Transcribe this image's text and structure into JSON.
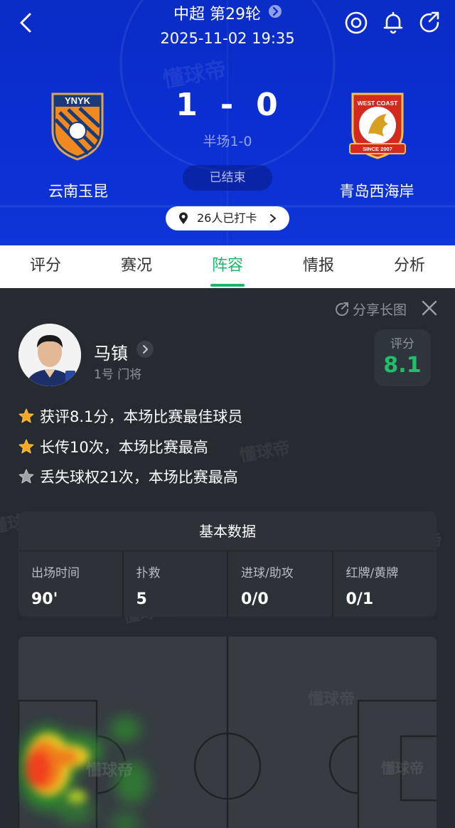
{
  "header": {
    "league_round": "中超 第29轮",
    "datetime": "2025-11-02 19:35",
    "score_home": "1",
    "score_sep": "-",
    "score_away": "0",
    "halftime": "半场1-0",
    "status": "已结束",
    "home_team": "云南玉昆",
    "away_team": "青岛西海岸",
    "checkin": "26人已打卡",
    "home_logo_text": "YNYK",
    "away_logo_text_top": "WEST COAST",
    "away_logo_text_bottom": "SINCE 2007",
    "watermark": "懂球帝",
    "colors": {
      "bg": "#0b2fd2",
      "accent": "#20b46a"
    }
  },
  "tabs": [
    {
      "label": "评分"
    },
    {
      "label": "赛况"
    },
    {
      "label": "阵容",
      "active": true
    },
    {
      "label": "情报"
    },
    {
      "label": "分析"
    }
  ],
  "player": {
    "share_label": "分享长图",
    "name": "马镇",
    "meta": "1号 门将",
    "rating_label": "评分",
    "rating": "8.1"
  },
  "highlights": [
    {
      "icon": "gold-star-icon",
      "text": "获评8.1分，本场比赛最佳球员"
    },
    {
      "icon": "gold-star-icon",
      "text": "长传10次，本场比赛最高"
    },
    {
      "icon": "silver-star-icon",
      "text": "丢失球权21次，本场比赛最高"
    }
  ],
  "stats": {
    "title": "基本数据",
    "items": [
      {
        "label": "出场时间",
        "value": "90'"
      },
      {
        "label": "扑救",
        "value": "5"
      },
      {
        "label": "进球/助攻",
        "value": "0/0"
      },
      {
        "label": "红牌/黄牌",
        "value": "0/1"
      }
    ]
  },
  "watermark": "懂球帝"
}
